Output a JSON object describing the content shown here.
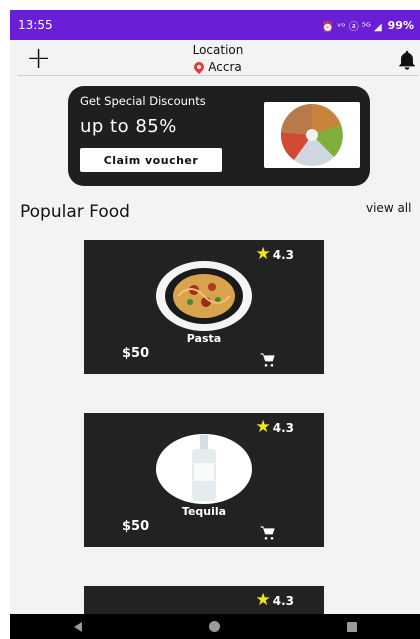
{
  "status_bar": {
    "time": "13:55",
    "indicators": "⏰ ᵛᵒ ⓐ ⁵ᴳ ◢",
    "battery": "99%"
  },
  "header": {
    "add_icon": "plus-icon",
    "location_label": "Location",
    "city": "Accra",
    "notification_icon": "bell-icon"
  },
  "promo": {
    "subtitle": "Get Special Discounts",
    "headline": "up to 85%",
    "button_label": "Claim voucher"
  },
  "section": {
    "title": "Popular Food",
    "view_all": "view all"
  },
  "foods": [
    {
      "name": "Pasta",
      "price": "$50",
      "rating": "4.3"
    },
    {
      "name": "Tequila",
      "price": "$50",
      "rating": "4.3"
    },
    {
      "name": "",
      "price": "",
      "rating": "4.3"
    }
  ],
  "colors": {
    "status_bar": "#6a1fd6",
    "card_bg": "#222222",
    "star": "#f5e51b",
    "pin": "#e53935"
  }
}
